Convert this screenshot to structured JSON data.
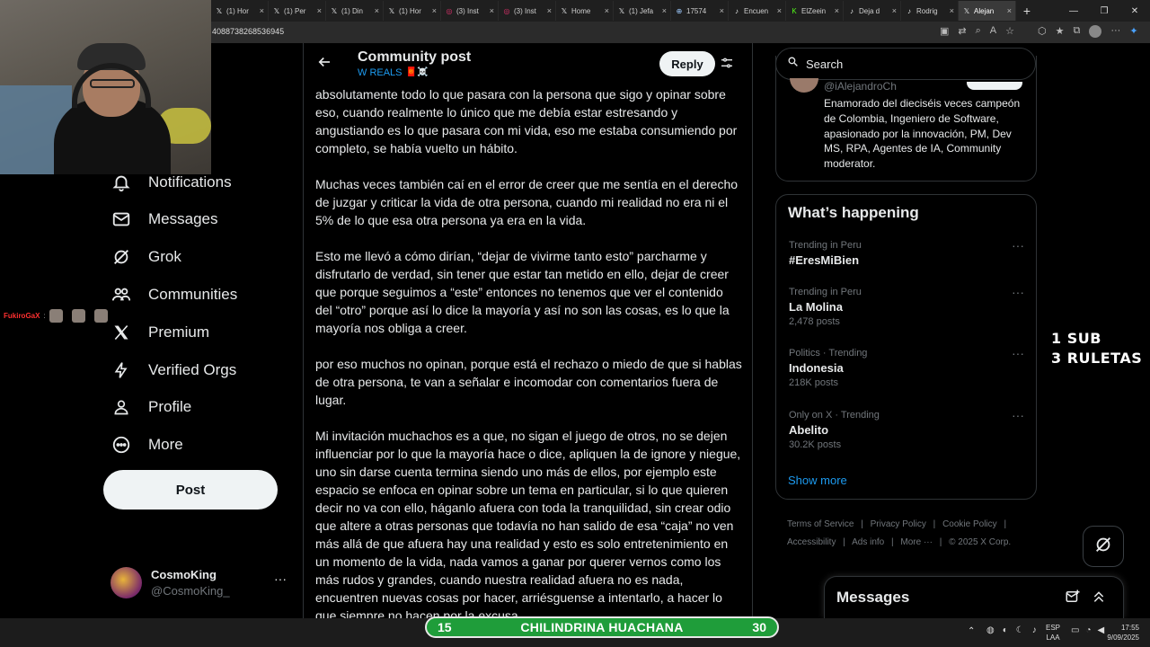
{
  "browser": {
    "tabs": [
      {
        "icon": "x-icon",
        "label": "(1) Hor"
      },
      {
        "icon": "x-icon",
        "label": "(1) Per"
      },
      {
        "icon": "x-icon",
        "label": "(1) Din"
      },
      {
        "icon": "x-icon",
        "label": "(1) Hor"
      },
      {
        "icon": "instagram-icon",
        "label": "(3) Inst"
      },
      {
        "icon": "instagram-icon",
        "label": "(3) Inst"
      },
      {
        "icon": "x-icon",
        "label": "Home"
      },
      {
        "icon": "x-icon",
        "label": "(1) Jefa"
      },
      {
        "icon": "globe-icon",
        "label": "17574"
      },
      {
        "icon": "tiktok-icon",
        "label": "Encuen"
      },
      {
        "icon": "kick-icon",
        "label": "ElZeein"
      },
      {
        "icon": "tiktok-icon",
        "label": "Deja d"
      },
      {
        "icon": "tiktok-icon",
        "label": "Rodrig"
      },
      {
        "icon": "x-icon",
        "label": "Alejan",
        "active": true
      }
    ],
    "new_tab_symbol": "+",
    "window_controls": [
      "—",
      "❐",
      "✕"
    ],
    "address_fragment": "4088738268536945"
  },
  "stream_overlay": {
    "chat_username": "FukiroGaX",
    "promo_line1": "1 SUB",
    "promo_line2": "3 RULETAS",
    "wheel_bar": {
      "left": "15",
      "center": "CHILINDRINA HUACHANA",
      "right": "30"
    }
  },
  "nav": {
    "items": [
      {
        "icon": "bell-icon",
        "label": "Notifications"
      },
      {
        "icon": "envelope-icon",
        "label": "Messages"
      },
      {
        "icon": "grok-icon",
        "label": "Grok"
      },
      {
        "icon": "people-icon",
        "label": "Communities"
      },
      {
        "icon": "x-logo-icon",
        "label": "Premium"
      },
      {
        "icon": "lightning-icon",
        "label": "Verified Orgs"
      },
      {
        "icon": "person-icon",
        "label": "Profile"
      },
      {
        "icon": "more-circle-icon",
        "label": "More"
      }
    ],
    "post_button": "Post",
    "account": {
      "name": "CosmoKing",
      "handle": "@CosmoKing_"
    }
  },
  "post": {
    "header_title": "Community post",
    "community_name": "W REALS",
    "community_emoji": "🧧☠️",
    "reply_button": "Reply",
    "paragraphs": [
      "absolutamente todo lo que pasara con la persona que sigo y opinar sobre eso, cuando realmente lo único que me debía estar estresando y angustiando es lo que pasara con mi vida, eso me estaba consumiendo por completo, se había vuelto un hábito.",
      "Muchas veces también caí en el error de creer que me sentía en el derecho de juzgar y criticar la vida de otra persona, cuando mi realidad no era ni el 5% de lo que esa otra persona ya era en la vida.",
      "Esto me llevó a cómo dirían, “dejar de vivirme tanto esto” parcharme y disfrutarlo de verdad, sin tener que estar tan metido en ello, dejar de creer que porque seguimos a “este” entonces no tenemos que ver el contenido del “otro” porque así lo dice la mayoría y así no son las cosas, es lo que la mayoría nos obliga a creer.",
      "por eso muchos no opinan, porque está el rechazo o miedo de que si hablas de otra persona, te van a señalar e incomodar con comentarios fuera de lugar.",
      "Mi invitación muchachos es a que, no sigan el juego de otros, no se dejen influenciar por lo que la mayoría hace o dice, apliquen la de ignore y niegue, uno sin darse cuenta termina siendo uno más de ellos, por ejemplo este espacio se enfoca en opinar sobre un tema en particular, si lo que quieren decir no va con ello, háganlo afuera con toda la tranquilidad, sin crear odio que altere a otras personas que todavía no han salido de esa “caja” no ven más allá de que afuera hay una realidad y esto es solo entretenimiento en un momento de la vida, nada vamos a ganar por querer vernos como los más rudos y grandes, cuando nuestra realidad afuera no es nada, encuentren nuevas cosas por hacer, arriésguense a intentarlo, a hacer lo que siempre no hacen por la excusa"
    ]
  },
  "sidebar": {
    "search_placeholder": "Search",
    "profile_card": {
      "handle": "@iAlejandroCh",
      "bio": "Enamorado del dieciséis veces campeón de Colombia, Ingeniero de Software, apasionado por la innovación, PM, Dev MS, RPA, Agentes de IA, Community moderator."
    },
    "whats_happening": {
      "title": "What’s happening",
      "trends": [
        {
          "meta": "Trending in Peru",
          "name": "#EresMiBien",
          "count": ""
        },
        {
          "meta": "Trending in Peru",
          "name": "La Molina",
          "count": "2,478 posts"
        },
        {
          "meta": "Politics · Trending",
          "name": "Indonesia",
          "count": "218K posts"
        },
        {
          "meta": "Only on X · Trending",
          "name": "Abelito",
          "count": "30.2K posts"
        }
      ],
      "show_more": "Show more"
    },
    "footer": {
      "terms": "Terms of Service",
      "privacy": "Privacy Policy",
      "cookie": "Cookie Policy",
      "accessibility": "Accessibility",
      "ads": "Ads info",
      "more": "More ···",
      "copyright": "© 2025 X Corp."
    },
    "messages_title": "Messages"
  },
  "taskbar": {
    "lang1": "ESP",
    "lang2": "LAA",
    "time": "17:55",
    "date": "9/09/2025"
  },
  "colors": {
    "accent": "#1d9bf0",
    "background": "#000000",
    "border": "#2f3336",
    "muted_text": "#71767b",
    "wheel_green": "#1f9d3a",
    "chat_name": "#ff3030"
  }
}
